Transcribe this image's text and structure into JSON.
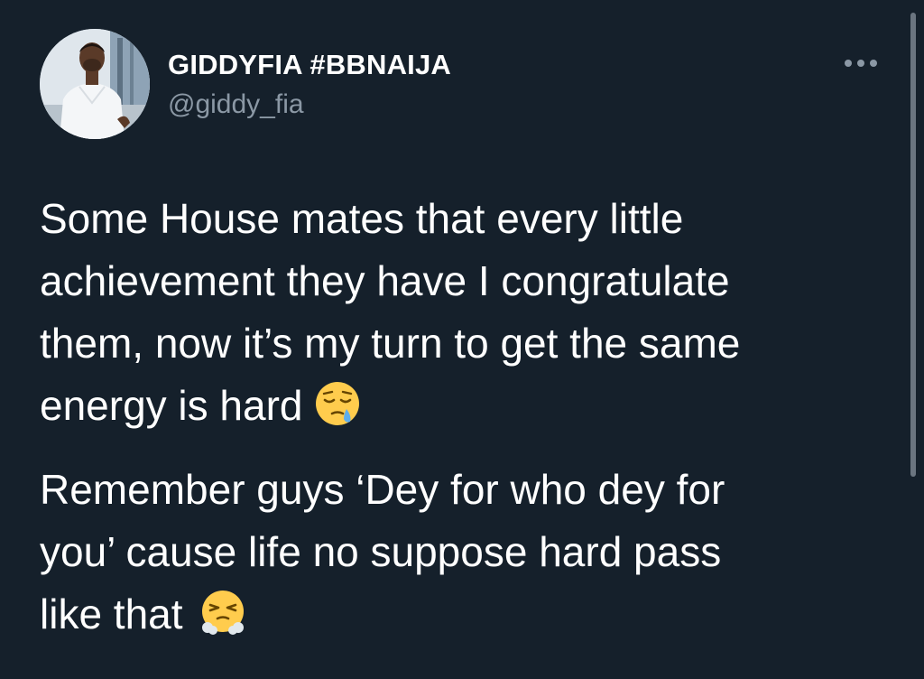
{
  "author": {
    "display_name": "GIDDYFIA #BBNAIJA",
    "handle": "@giddy_fia",
    "avatar_icon": "profile-photo"
  },
  "more_icon": "more-horizontal-icon",
  "tweet": {
    "paragraph1_lines": [
      "Some House mates that every little",
      "achievement they have I congratulate",
      "them, now it’s my turn to get the same",
      "energy is hard"
    ],
    "paragraph1_emoji": "sleepy-face-emoji",
    "paragraph2_lines": [
      "Remember guys ‘Dey for who dey for",
      "you’ cause life no suppose hard pass",
      "like that"
    ],
    "paragraph2_emoji": "face-with-steam-from-nose-emoji"
  },
  "colors": {
    "background": "#15202b",
    "primary_text": "#ffffff",
    "secondary_text": "#8b98a5"
  }
}
